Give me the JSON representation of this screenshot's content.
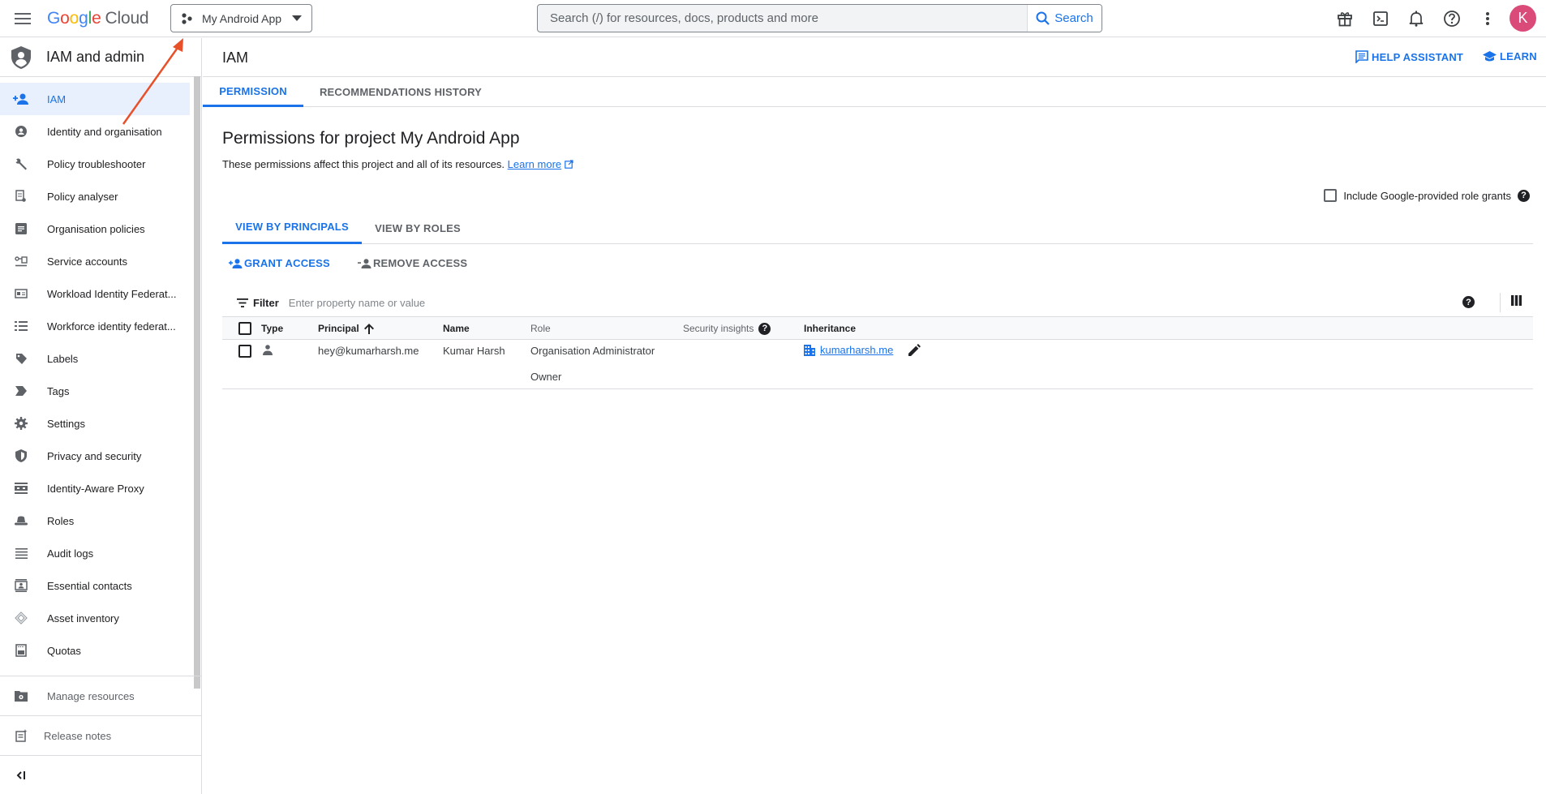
{
  "topbar": {
    "menu_icon": "hamburger-menu-icon",
    "logo_parts": [
      "G",
      "o",
      "o",
      "g",
      "l",
      "e"
    ],
    "logo_suffix": "Cloud",
    "project": "My Android App",
    "search_placeholder": "Search (/) for resources, docs, products and more",
    "search_button": "Search",
    "icons": [
      "gift-icon",
      "cloud-shell-icon",
      "notifications-icon",
      "help-icon",
      "more-vert-icon"
    ],
    "avatar_letter": "K",
    "avatar_color": "#db4b7a"
  },
  "sidebar": {
    "title": "IAM and admin",
    "items": [
      {
        "label": "IAM",
        "icon": "person-add-icon",
        "active": true
      },
      {
        "label": "Identity and organisation",
        "icon": "account-circle-icon"
      },
      {
        "label": "Policy troubleshooter",
        "icon": "wrench-icon"
      },
      {
        "label": "Policy analyser",
        "icon": "policy-search-icon"
      },
      {
        "label": "Organisation policies",
        "icon": "document-icon"
      },
      {
        "label": "Service accounts",
        "icon": "service-account-icon"
      },
      {
        "label": "Workload Identity Federat...",
        "icon": "id-card-icon"
      },
      {
        "label": "Workforce identity federat...",
        "icon": "list-icon"
      },
      {
        "label": "Labels",
        "icon": "label-tag-icon"
      },
      {
        "label": "Tags",
        "icon": "tag-arrow-icon"
      },
      {
        "label": "Settings",
        "icon": "gear-icon"
      },
      {
        "label": "Privacy and security",
        "icon": "shield-icon"
      },
      {
        "label": "Identity-Aware Proxy",
        "icon": "proxy-icon"
      },
      {
        "label": "Roles",
        "icon": "hat-icon"
      },
      {
        "label": "Audit logs",
        "icon": "lines-icon"
      },
      {
        "label": "Essential contacts",
        "icon": "contact-icon"
      },
      {
        "label": "Asset inventory",
        "icon": "diamond-layers-icon"
      },
      {
        "label": "Quotas",
        "icon": "quota-icon"
      }
    ],
    "manage_resources": "Manage resources",
    "release_notes": "Release notes",
    "collapse_icon": "collapse-sidebar-icon"
  },
  "header": {
    "title": "IAM",
    "help_assistant": "HELP ASSISTANT",
    "learn": "LEARN"
  },
  "tabs": [
    {
      "label": "PERMISSION",
      "active": true
    },
    {
      "label": "RECOMMENDATIONS HISTORY",
      "active": false
    }
  ],
  "permissions": {
    "title": "Permissions for project My Android App",
    "description": "These permissions affect this project and all of its resources.",
    "learn_more": "Learn more",
    "google_grants_label": "Include Google-provided role grants",
    "google_grants_checked": false
  },
  "subtabs": [
    {
      "label": "VIEW BY PRINCIPALS",
      "active": true
    },
    {
      "label": "VIEW BY ROLES",
      "active": false
    }
  ],
  "actions": {
    "grant": "GRANT ACCESS",
    "remove": "REMOVE ACCESS"
  },
  "filter": {
    "label": "Filter",
    "placeholder": "Enter property name or value"
  },
  "table": {
    "columns": [
      "Type",
      "Principal",
      "Name",
      "Role",
      "Security insights",
      "Inheritance"
    ],
    "sort_column": "Principal",
    "sort_direction": "ascending",
    "rows": [
      {
        "type": "user",
        "principal": "hey@kumarharsh.me",
        "name": "Kumar Harsh",
        "roles": [
          "Organisation Administrator",
          "Owner"
        ],
        "security_insights": "",
        "inheritance": "kumarharsh.me"
      }
    ]
  },
  "annotation": {
    "arrow_color": "#e8502a"
  }
}
